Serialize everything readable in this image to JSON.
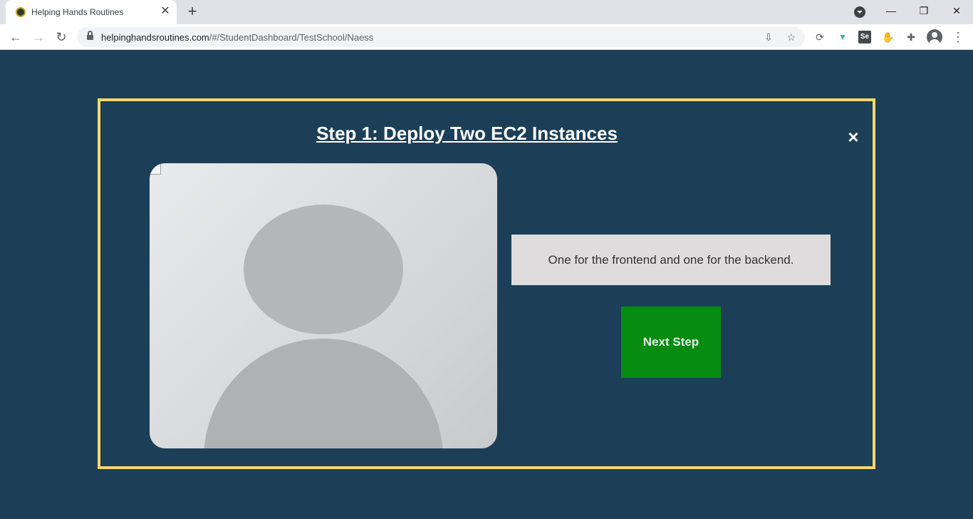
{
  "browser": {
    "tab_title": "Helping Hands Routines",
    "tab_close": "✕",
    "new_tab": "+",
    "url_domain": "helpinghandsroutines.com",
    "url_path": "/#/StudentDashboard/TestSchool/Naess",
    "window_controls": {
      "minimize": "—",
      "restore": "❐",
      "close": "✕"
    },
    "nav": {
      "back": "←",
      "forward": "→",
      "reload": "↻"
    },
    "omnibox_icons": {
      "install": "⇩",
      "bookmark": "☆"
    },
    "extensions": [
      {
        "name": "sync-extension-icon",
        "glyph": "⟳",
        "color": "#5f6368"
      },
      {
        "name": "vue-devtools-icon",
        "glyph": "▼",
        "color": "#41b883"
      },
      {
        "name": "selenium-ide-icon",
        "glyph": "Se",
        "color": "#ffffff"
      },
      {
        "name": "hand-extension-icon",
        "glyph": "✋",
        "color": "#c9a227"
      },
      {
        "name": "puzzle-extensions-icon",
        "glyph": "✚",
        "color": "#5f6368"
      }
    ],
    "menu": "⋮"
  },
  "modal": {
    "title": "Step 1: Deploy Two EC2 Instances",
    "close_label": "×",
    "caption": "One for the frontend and one for the backend.",
    "next_button": "Next Step",
    "colors": {
      "border": "#f5d76e",
      "background": "#1c3f57",
      "button": "#078c12"
    }
  }
}
